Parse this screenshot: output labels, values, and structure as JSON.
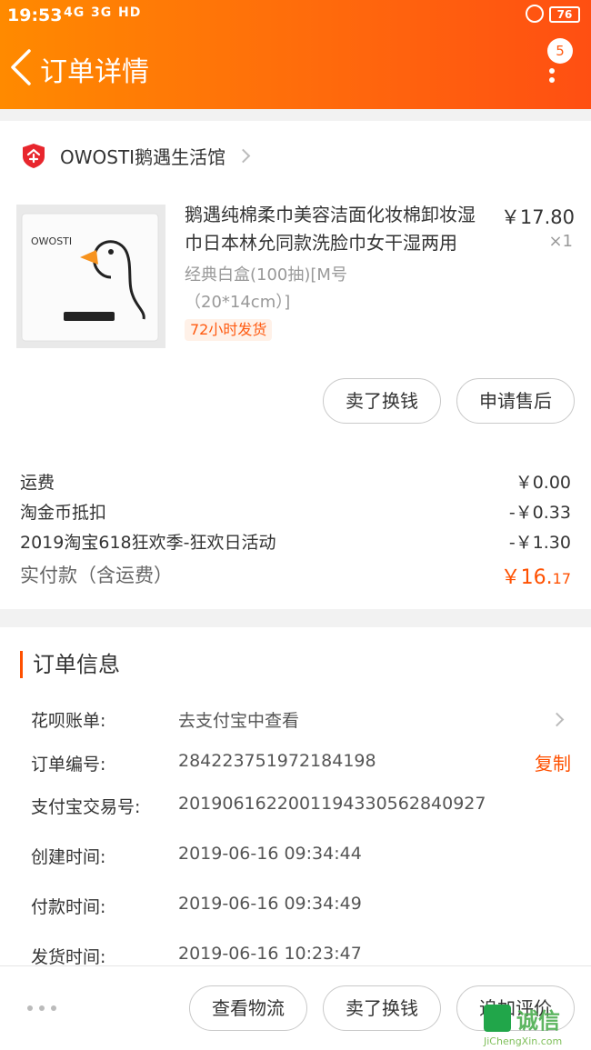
{
  "status_bar": {
    "time": "19:53",
    "signal1": "4G",
    "signal2": "3G",
    "hd": "HD",
    "battery": "76"
  },
  "header": {
    "title": "订单详情",
    "badge_count": "5"
  },
  "shop": {
    "name": "OWOSTI鹅遇生活馆"
  },
  "goods": {
    "title": "鹅遇纯棉柔巾美容洁面化妆棉卸妆湿巾日本林允同款洗脸巾女干湿两用",
    "sku": "经典白盒(100抽)[M号（20*14cm）]",
    "tag": "72小时发货",
    "price": "￥17.80",
    "quantity": "×1",
    "thumb_brand": "OWOSTI"
  },
  "goods_actions": {
    "sell": "卖了换钱",
    "after_sale": "申请售后"
  },
  "fees": [
    {
      "label": "运费",
      "value": "￥0.00"
    },
    {
      "label": "淘金币抵扣",
      "value": "-￥0.33"
    },
    {
      "label": "2019淘宝618狂欢季-狂欢日活动",
      "value": "-￥1.30"
    }
  ],
  "total": {
    "label": "实付款（含运费）",
    "value_main": "￥16.",
    "value_cents": "17"
  },
  "order_info": {
    "title": "订单信息",
    "rows": [
      {
        "label": "花呗账单:",
        "value": "去支付宝中查看"
      },
      {
        "label": "订单编号:",
        "value": "284223751972184198",
        "action": "复制"
      },
      {
        "label": "支付宝交易号:",
        "value": "2019061622001194330562840927"
      },
      {
        "label": "创建时间:",
        "value": "2019-06-16 09:34:44"
      },
      {
        "label": "付款时间:",
        "value": "2019-06-16 09:34:49"
      },
      {
        "label": "发货时间:",
        "value": "2019-06-16 10:23:47"
      }
    ]
  },
  "bottom_bar": {
    "logistics": "查看物流",
    "sell": "卖了换钱",
    "review": "追加评价"
  },
  "watermark": {
    "text": "诚信",
    "url": "JiChengXin.com"
  },
  "colors": {
    "accent": "#ff5000",
    "header_start": "#ff8a00",
    "header_end": "#ff4f12"
  },
  "icons": [
    "back-arrow-icon",
    "more-icon",
    "shop-logo-icon",
    "chevron-right-icon",
    "ellipsis-icon"
  ]
}
